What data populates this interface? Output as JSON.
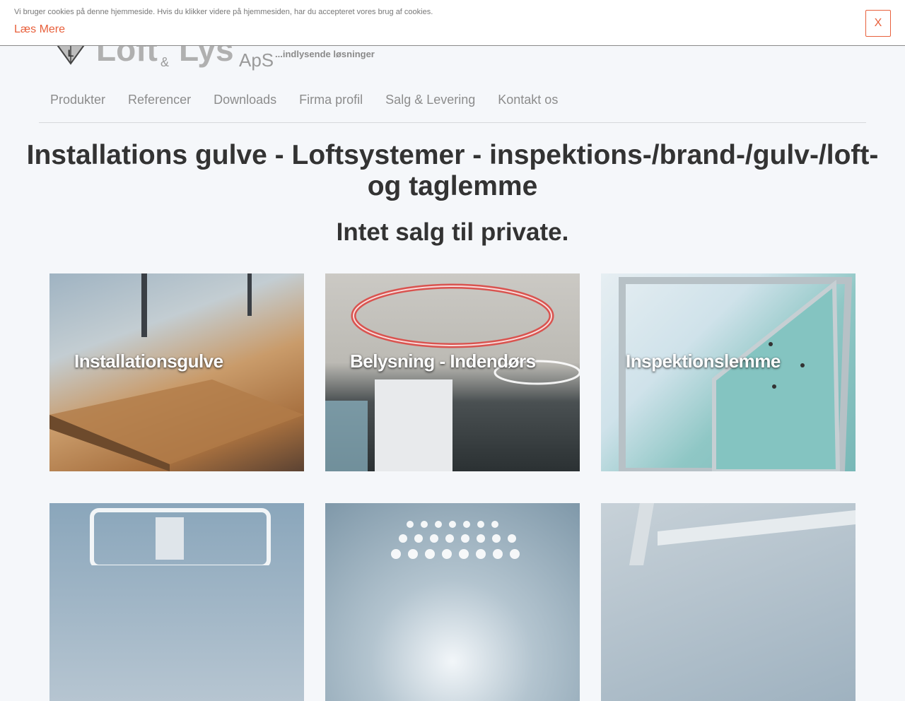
{
  "cookie": {
    "text": "Vi bruger cookies på denne hjemmeside. Hvis du klikker videre på hjemmesiden, har du accepteret vores brug af cookies.",
    "more_label": "Læs Mere",
    "close_label": "X"
  },
  "logo": {
    "word1": "Loft",
    "amp": "&",
    "word2": "Lys",
    "suffix": "ApS",
    "tagline": "...indlysende løsninger"
  },
  "nav": {
    "items": [
      {
        "label": "Produkter"
      },
      {
        "label": "Referencer"
      },
      {
        "label": "Downloads"
      },
      {
        "label": "Firma profil"
      },
      {
        "label": "Salg & Levering"
      },
      {
        "label": "Kontakt os"
      }
    ]
  },
  "main": {
    "title": "Installations gulve - Loftsystemer - inspektions-/brand-/gulv-/loft- og taglemme",
    "subtitle": "Intet salg til private.",
    "tiles": [
      {
        "label": "Installationsgulve"
      },
      {
        "label": "Belysning - Indendørs"
      },
      {
        "label": "Inspektionslemme"
      },
      {
        "label": ""
      },
      {
        "label": ""
      },
      {
        "label": ""
      }
    ]
  },
  "colors": {
    "accent": "#e8603c",
    "nav_text": "#8c8c8c",
    "heading": "#333333"
  }
}
